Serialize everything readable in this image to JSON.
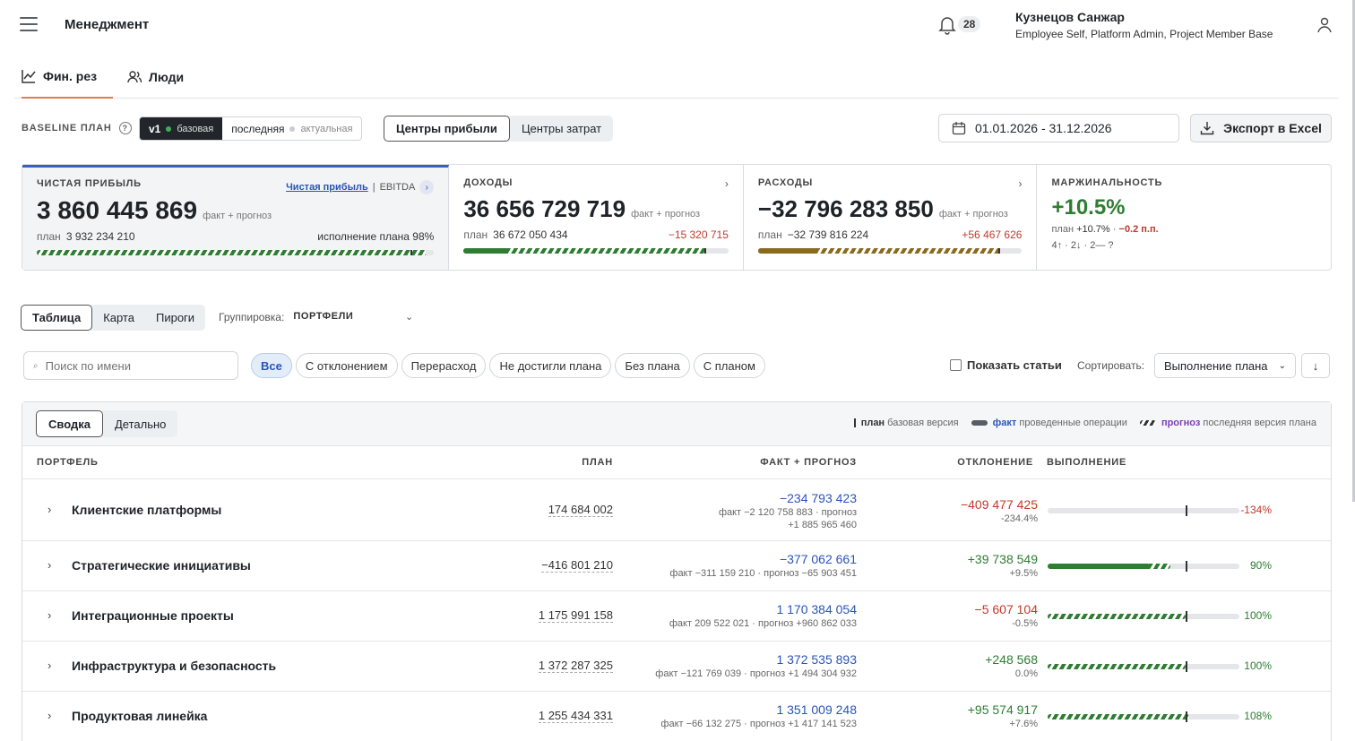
{
  "header": {
    "title": "Менеджмент",
    "notifications": "28",
    "user_name": "Кузнецов Санжар",
    "user_roles": "Employee Self, Platform Admin, Project Member Base"
  },
  "tabs": [
    {
      "label": "Фин. рез",
      "active": true
    },
    {
      "label": "Люди",
      "active": false
    }
  ],
  "baseline": {
    "label": "BASELINE ПЛАН",
    "v1_label": "v1",
    "v1_note": "базовая",
    "last_label": "последняя",
    "last_note": "актуальная"
  },
  "centers": {
    "profit": "Центры прибыли",
    "cost": "Центры затрат"
  },
  "date_range": "01.01.2026 - 31.12.2026",
  "export_label": "Экспорт в Excel",
  "kpis": {
    "net": {
      "title": "ЧИСТАЯ ПРИБЫЛЬ",
      "link_net": "Чистая прибыль",
      "link_sep": "|",
      "link_ebitda": "EBITDA",
      "value": "3 860 445 869",
      "value_note": "факт + прогноз",
      "plan_label": "план",
      "plan_value": "3 932 234 210",
      "execution": "исполнение плана 98%",
      "bar_fill": 0.98,
      "color": "#2e7d32"
    },
    "income": {
      "title": "ДОХОДЫ",
      "value": "36 656 729 719",
      "value_note": "факт + прогноз",
      "plan_label": "план",
      "plan_value": "36 672 050 434",
      "deviation": "−15 320 715",
      "bar_fill": 0.91,
      "color": "#2e7d32"
    },
    "expenses": {
      "title": "РАСХОДЫ",
      "value": "−32 796 283 850",
      "value_note": "факт + прогноз",
      "plan_label": "план",
      "plan_value": "−32 739 816 224",
      "deviation": "+56 467 626",
      "bar_fill": 0.91,
      "color": "#8a6a1f"
    },
    "margin": {
      "title": "МАРЖИНАЛЬНОСТЬ",
      "value": "+10.5%",
      "plan_label": "план",
      "plan_value": "+10.7%",
      "plan_sep": "·",
      "delta": "−0.2 п.п.",
      "stats": "4↑ · 2↓ · 2— ?"
    }
  },
  "view_tabs": [
    "Таблица",
    "Карта",
    "Пироги"
  ],
  "grouping": {
    "label": "Группировка:",
    "value": "ПОРТФЕЛИ"
  },
  "search_placeholder": "Поиск по имени",
  "filters": [
    "Все",
    "С отклонением",
    "Перерасход",
    "Не достигли плана",
    "Без плана",
    "С планом"
  ],
  "show_items_label": "Показать статьи",
  "sort": {
    "label": "Сортировать:",
    "value": "Выполнение плана"
  },
  "panel": {
    "tabs": [
      "Сводка",
      "Детально"
    ],
    "legend": {
      "plan": "план",
      "plan_note": "базовая версия",
      "fact": "факт",
      "fact_note": "проведенные операции",
      "forecast": "прогноз",
      "forecast_note": "последняя версия плана"
    },
    "columns": {
      "portfolio": "ПОРТФЕЛЬ",
      "plan": "ПЛАН",
      "fact": "ФАКТ + ПРОГНОЗ",
      "deviation": "ОТКЛОНЕНИЕ",
      "execution": "ВЫПОЛНЕНИЕ"
    }
  },
  "rows": [
    {
      "name": "Клиентские платформы",
      "plan": "174 684 002",
      "fact": "−234 793 423",
      "fact_sub_1": "факт −2 120 758 883 · прогноз",
      "fact_sub_2": "+1 885 965 460",
      "dev": "−409 477 425",
      "dev_pct": "-234.4%",
      "dev_sign": "neg",
      "pct": "-134%",
      "fill": 0.0,
      "mark": 0.72
    },
    {
      "name": "Стратегические инициативы",
      "plan": "−416 801 210",
      "fact": "−377 062 661",
      "fact_sub_1": "факт −311 159 210 · прогноз −65 903 451",
      "fact_sub_2": "",
      "dev": "+39 738 549",
      "dev_pct": "+9.5%",
      "dev_sign": "pos",
      "pct": "90%",
      "fill": 0.64,
      "mark": 0.72
    },
    {
      "name": "Интеграционные проекты",
      "plan": "1 175 991 158",
      "fact": "1 170 384 054",
      "fact_sub_1": "факт 209 522 021 · прогноз +960 862 033",
      "fact_sub_2": "",
      "dev": "−5 607 104",
      "dev_pct": "-0.5%",
      "dev_sign": "neg",
      "pct": "100%",
      "fill": 0.72,
      "mark": 0.72
    },
    {
      "name": "Инфраструктура и безопасность",
      "plan": "1 372 287 325",
      "fact": "1 372 535 893",
      "fact_sub_1": "факт −121 769 039 · прогноз +1 494 304 932",
      "fact_sub_2": "",
      "dev": "+248 568",
      "dev_pct": "0.0%",
      "dev_sign": "pos",
      "pct": "100%",
      "fill": 0.72,
      "mark": 0.72
    },
    {
      "name": "Продуктовая линейка",
      "plan": "1 255 434 331",
      "fact": "1 351 009 248",
      "fact_sub_1": "факт −66 132 275 · прогноз +1 417 141 523",
      "fact_sub_2": "",
      "dev": "+95 574 917",
      "dev_pct": "+7.6%",
      "dev_sign": "pos",
      "pct": "108%",
      "fill": 0.74,
      "mark": 0.72
    }
  ]
}
